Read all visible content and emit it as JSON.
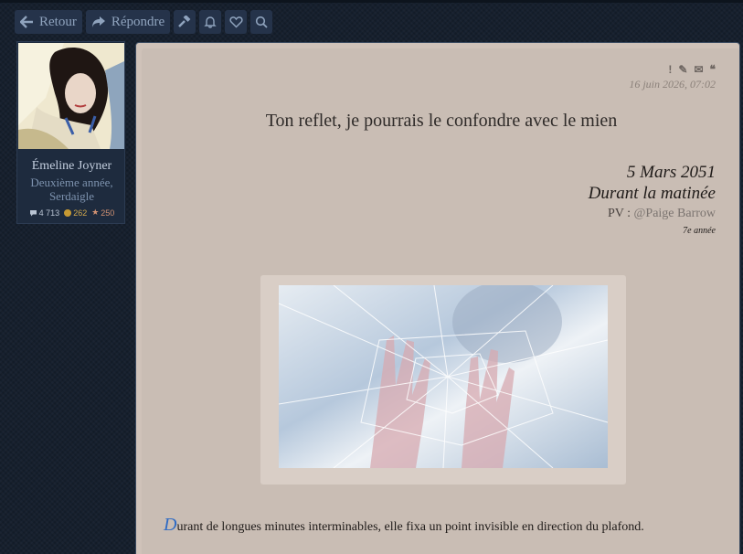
{
  "toolbar": {
    "back_label": "Retour",
    "reply_label": "Répondre",
    "icons": [
      "arrow-left-icon",
      "reply-icon",
      "hammer-icon",
      "bell-icon",
      "heart-icon",
      "search-icon"
    ]
  },
  "author": {
    "name": "Émeline Joyner",
    "rank": "Deuxième année, Serdaigle",
    "messages": "4 713",
    "galleons": "262",
    "points": "250"
  },
  "post": {
    "tools": [
      "!",
      "✎",
      "✉",
      "❝"
    ],
    "date": "16 juin 2026, 07:02",
    "title": "Ton reflet, je pourrais le confondre avec le mien",
    "rp_date": "5 Mars 2051",
    "rp_time": "Durant la matinée",
    "pv_label": "PV : ",
    "pv_link": "@Paige Barrow",
    "year_note": "7e année",
    "drop_cap": "D",
    "paragraph": "urant de longues minutes interminables, elle fixa un point invisible en direction du plafond."
  },
  "colors": {
    "background": "#16202e",
    "toolbar_button": "#25334a",
    "post_background": "#c9bdb4",
    "drop_cap": "#2f6bc4"
  }
}
